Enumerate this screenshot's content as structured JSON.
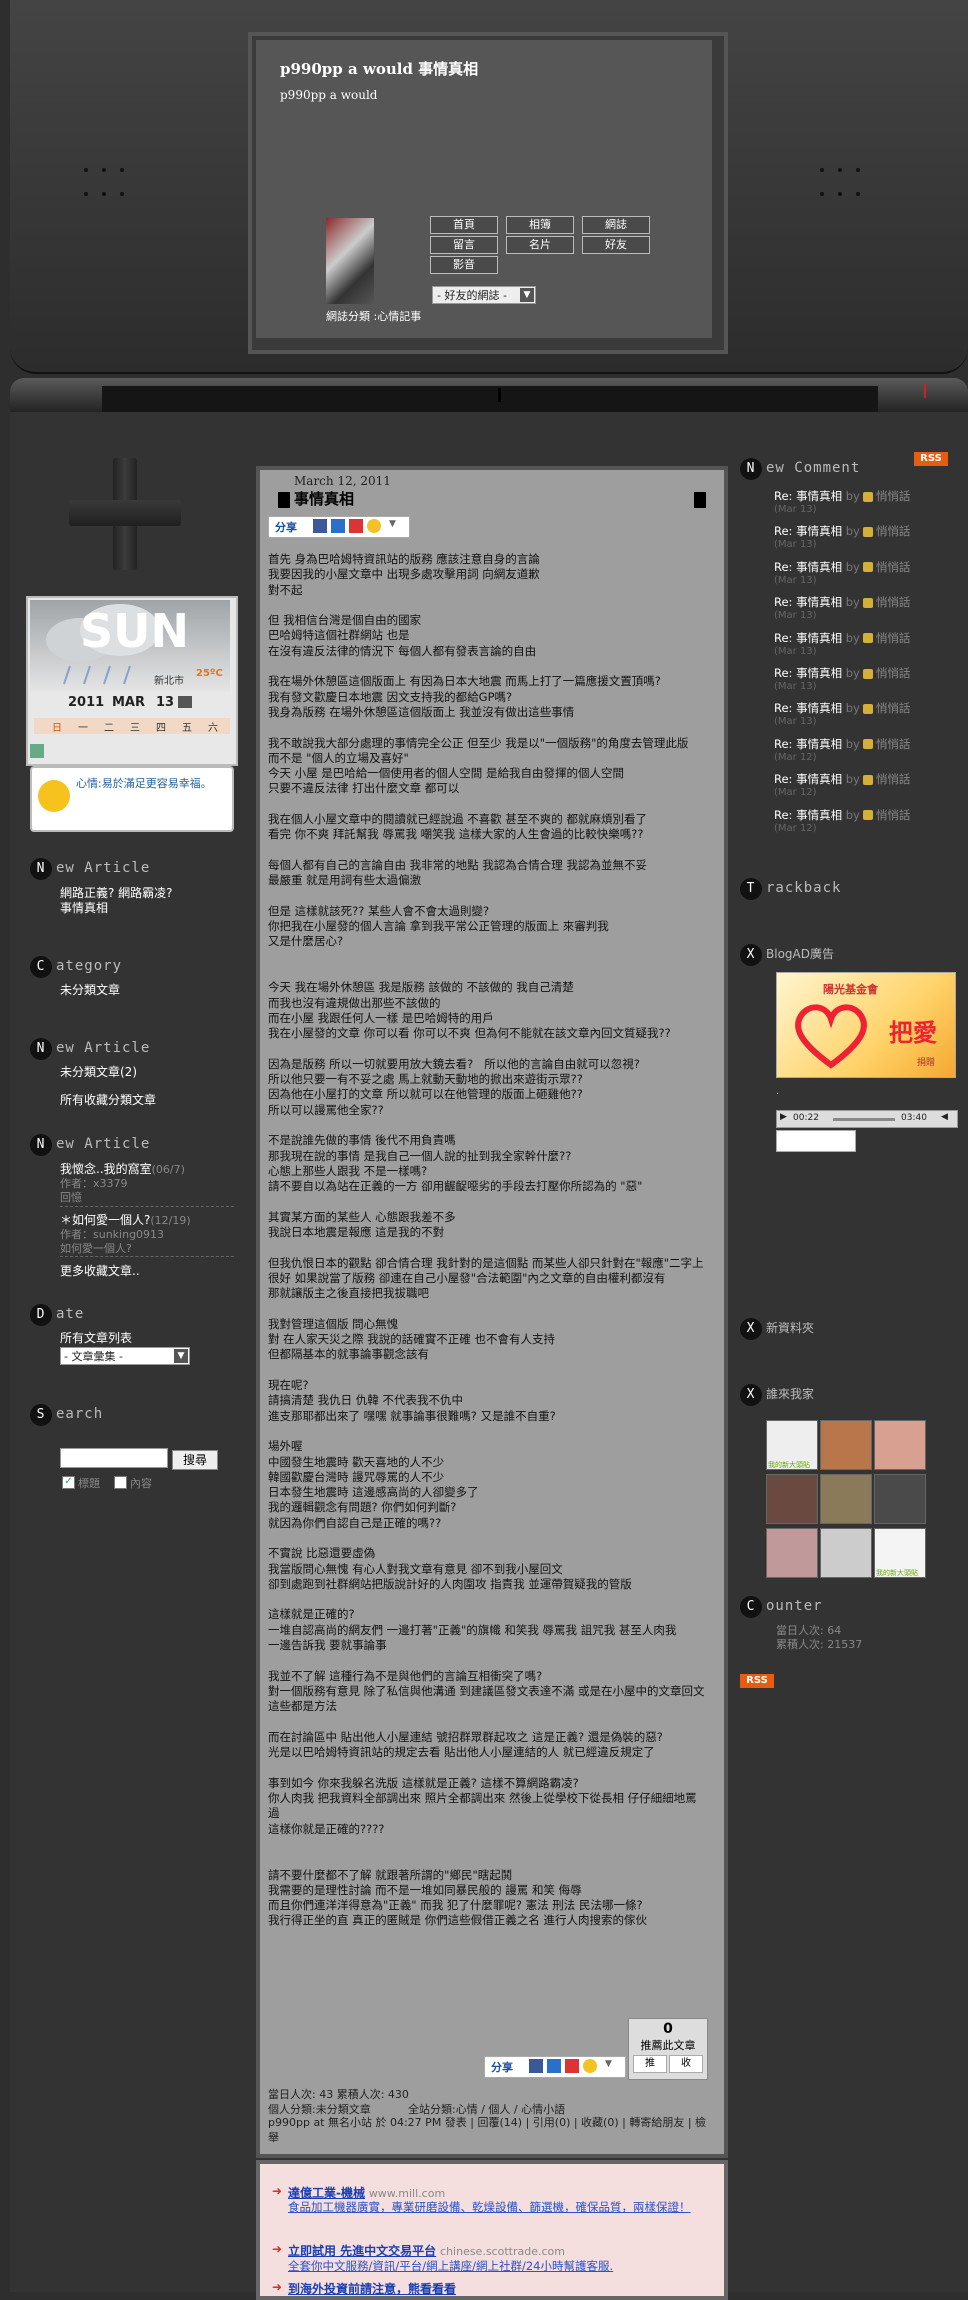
{
  "blog": {
    "title": "p990pp a would 事情真相",
    "subtitle": "p990pp a would",
    "nav": [
      "首頁",
      "相簿",
      "網誌",
      "留言",
      "名片",
      "好友",
      "影音"
    ],
    "friend_select": "- 好友的網誌 -",
    "category_line": "網誌分類 :心情記事"
  },
  "weather": {
    "word": "SUN",
    "city": "新北市",
    "temp": "25ºC",
    "year": "2011",
    "month": "MAR",
    "day": "13",
    "weekdays": [
      "日",
      "一",
      "二",
      "三",
      "四",
      "五",
      "六"
    ],
    "mood_text": "心情:易於滿足更容易幸福。"
  },
  "left": {
    "new_article_1": {
      "header": "ew Article",
      "letter": "N",
      "items": [
        "網路正義? 網路霸凌?",
        "事情真相"
      ]
    },
    "category": {
      "header": "ategory",
      "letter": "C",
      "items": [
        "未分類文章"
      ]
    },
    "new_article_2": {
      "header": "ew Article",
      "letter": "N",
      "items": [
        "未分類文章(2)",
        "所有收藏分類文章"
      ]
    },
    "new_article_3": {
      "header": "ew Article",
      "letter": "N",
      "entries": [
        {
          "title": "我懷念..我的窩室",
          "date": "(06/7)",
          "author": "作者：x3379",
          "extra": "回憶"
        },
        {
          "title": "＊如何愛一個人?",
          "date": "(12/19)",
          "author": "作者：sunking0913",
          "extra": "如何愛一個人?"
        }
      ],
      "more": "更多收藏文章.."
    },
    "date": {
      "header": "ate",
      "letter": "D",
      "items": [
        "所有文章列表"
      ],
      "select": "- 文章彙集 -"
    },
    "search": {
      "header": "earch",
      "letter": "S",
      "button": "搜尋",
      "opt1": "標題",
      "opt2": "內容"
    }
  },
  "post": {
    "date": "March 12, 2011",
    "title": "事情真相",
    "share_label": "分享",
    "body": "首先 身為巴哈姆特資訊站的版務 應該注意自身的言論\n我要因我的小屋文章中 出現多處攻擊用詞 向網友道歉\n對不起\n\n但 我相信台灣是個自由的國家\n巴哈姆特這個社群網站 也是\n在沒有違反法律的情況下 每個人都有發表言論的自由\n\n我在場外休憩區這個版面上 有因為日本大地震 而馬上打了一篇應援文置頂嗎?\n我有發文歡慶日本地震 因文支持我的都給GP嗎?\n我身為版務 在場外休憩區這個版面上 我並沒有做出這些事情\n\n我不敢說我大部分處理的事情完全公正 但至少 我是以\"一個版務\"的角度去管理此版\n而不是 \"個人的立場及喜好\"\n今天 小屋 是巴哈給一個使用者的個人空間 是給我自由發揮的個人空間\n只要不違反法律 打出什麼文章 都可以\n\n我在個人小屋文章中的閱讀就已經說過 不喜歡 甚至不爽的 都就麻煩別看了\n看完 你不爽 拜託幫我 辱罵我 嘲笑我 這樣大家的人生會過的比較快樂嗎??\n\n每個人都有自己的言論自由 我非常的地點 我認為合情合理 我認為並無不妥\n最嚴重 就是用詞有些太過偏激\n\n但是 這樣就該死?? 某些人會不會太過則變?\n你把我在小屋發的個人言論 拿到我平常公正管理的版面上 來審判我\n又是什麼居心?\n\n\n今天 我在場外休憩區 我是版務 該做的 不該做的 我自己清楚\n而我也沒有違規做出那些不該做的\n而在小屋 我跟任何人一樣 是巴哈姆特的用戶\n我在小屋發的文章 你可以看 你可以不爽 但為何不能就在該文章內回文質疑我??\n\n因為是版務 所以一切就要用放大鏡去看?   所以他的言論自由就可以忽視?\n所以他只要一有不妥之處 馬上就動天動地的掀出來遊街示眾??\n因為他在小屋打的文章 所以就可以在他管理的版面上砸雞他??\n所以可以謾罵他全家??\n\n不是說誰先做的事情 後代不用負責嗎\n那我現在說的事情 是我自己一個人說的扯到我全家幹什麼??\n心態上那些人跟我 不是一樣嗎?\n請不要自以為站在正義的一方 卻用齷齪噁劣的手段去打壓你所認為的 \"惡\"\n\n其實某方面的某些人 心態跟我差不多\n我說日本地震是報應 這是我的不對\n\n但我仇恨日本的觀點 卻合情合理 我針對的是這個點 而某些人卻只針對在\"報應\"二字上\n很好 如果說當了版務 卻連在自己小屋發\"合法範圍\"內之文章的自由權利都沒有\n那就讓版主之後直接把我拔職吧\n\n我對管理這個版 問心無愧\n對 在人家天災之際 我說的話確實不正確 也不會有人支持\n但都隔基本的就事論事觀念該有\n\n現在呢?\n請搞清楚 我仇日 仇韓 不代表我不仇中\n進支那耶都出來了 嘿嘿 就事論事很難嗎? 又是誰不自重?\n\n場外喔\n中國發生地震時 歡天喜地的人不少\n韓國歡慶台灣時 謾咒辱罵的人不少\n日本發生地震時 這邊感高尚的人卻變多了\n我的邏輯觀念有問題? 你們如何判斷?\n就因為你們自認自己是正確的嗎??\n\n不實說 比惡還要虛偽\n我當版問心無愧 有心人對我文章有意見 卻不到我小屋回文\n卻到處跑到社群網站把版說計好的人肉圍攻 指責我 並運帶賀疑我的管版\n\n這樣就是正確的?\n一堆自認高尚的網友們 一邊打著\"正義\"的旗幟 和笑我 辱罵我 詛咒我 甚至人肉我\n一邊告訴我 要就事論事\n\n我並不了解 這種行為不是與他們的言論互相衝突了嗎?\n對一個版務有意見 除了私信與他溝通 到建議區發文表達不滿 或是在小屋中的文章回文\n這些都是方法\n\n而在討論區中 貼出他人小屋連結 號招群眾群起攻之 這是正義? 還是偽裝的惡?\n光是以巴哈姆特資訊站的規定去看 貼出他人小屋連結的人 就已經違反規定了\n\n事到如今 你來我躲名洗版 這樣就是正義? 這樣不算網路霸凌?\n你人肉我 把我資料全部調出來 照片全都調出來 然後上從學校下從長相 仔仔細細地罵過\n這樣你就是正確的????\n\n\n請不要什麼都不了解 就跟著所謂的\"鄉民\"瞎起鬨\n我需要的是理性討論 而不是一堆如同暴民般的 謾罵 和笑 侮辱\n而且你們連洋洋得意為\"正義\" 而我 犯了什麼罪呢? 憲法 刑法 民法哪一條?\n我行得正坐的直 真正的匿賊是 你們這些假借正義之名 進行人肉搜索的傢伙",
    "recommend_count": "0",
    "recommend_label": "推薦此文章",
    "rec_btn1": "推",
    "rec_btn2": "收",
    "stats": "當日人次: 43 累積人次: 430",
    "personal_cat": "個人分類:未分類文章",
    "site_cat": "全站分類:心情 / 個人 / 心情小語",
    "footer": "p990pp at 無名小站 於 04:27 PM 發表 | 回覆(14) | 引用(0) | 收藏(0) | 轉寄給朋友 | 檢舉"
  },
  "ads": [
    {
      "title": "達億工業-機械",
      "url": "www.mill.com",
      "desc": "食品加工機器廣實，專業研磨設備、乾燥設備、篩選機，確保品質，兩樣保證！"
    },
    {
      "title": "立即試用 先進中文交易平台",
      "url": "chinese.scottrade.com",
      "desc": "全套你中文服務/資訊/平台/網上講座/網上社群/24小時幫護客服."
    },
    {
      "title": "到海外投資前請注意，熊看看看",
      "url": "",
      "desc": ""
    }
  ],
  "right": {
    "rss": "RSS",
    "comment_header": "ew Comment",
    "comment_letter": "N",
    "comments": [
      {
        "title": "Re: 事情真相",
        "by": "by",
        "author": "悄悄話",
        "date": "(Mar 13)"
      },
      {
        "title": "Re: 事情真相",
        "by": "by",
        "author": "悄悄話",
        "date": "(Mar 13)"
      },
      {
        "title": "Re: 事情真相",
        "by": "by",
        "author": "悄悄話",
        "date": "(Mar 13)"
      },
      {
        "title": "Re: 事情真相",
        "by": "by",
        "author": "悄悄話",
        "date": "(Mar 13)"
      },
      {
        "title": "Re: 事情真相",
        "by": "by",
        "author": "悄悄話",
        "date": "(Mar 13)"
      },
      {
        "title": "Re: 事情真相",
        "by": "by",
        "author": "悄悄話",
        "date": "(Mar 13)"
      },
      {
        "title": "Re: 事情真相",
        "by": "by",
        "author": "悄悄話",
        "date": "(Mar 13)"
      },
      {
        "title": "Re: 事情真相",
        "by": "by",
        "author": "悄悄話",
        "date": "(Mar 12)"
      },
      {
        "title": "Re: 事情真相",
        "by": "by",
        "author": "悄悄話",
        "date": "(Mar 12)"
      },
      {
        "title": "Re: 事情真相",
        "by": "by",
        "author": "悄悄話",
        "date": "(Mar 12)"
      }
    ],
    "trackback_header": "rackback",
    "trackback_letter": "T",
    "blogad_title": "BlogAD廣告",
    "banner_text1": "陽光基金會",
    "banner_text2": "把愛",
    "banner_text3": "捐贈",
    "player_time1": "00:22",
    "player_time2": "03:40",
    "news_title": "新資料夾",
    "friends_title": "誰來我家",
    "friend_tag": "我的新大頭貼",
    "counter_header": "ounter",
    "counter_letter": "C",
    "counter_today": "當日人次: 64",
    "counter_total": "累積人次: 21537",
    "rss2": "RSS"
  }
}
